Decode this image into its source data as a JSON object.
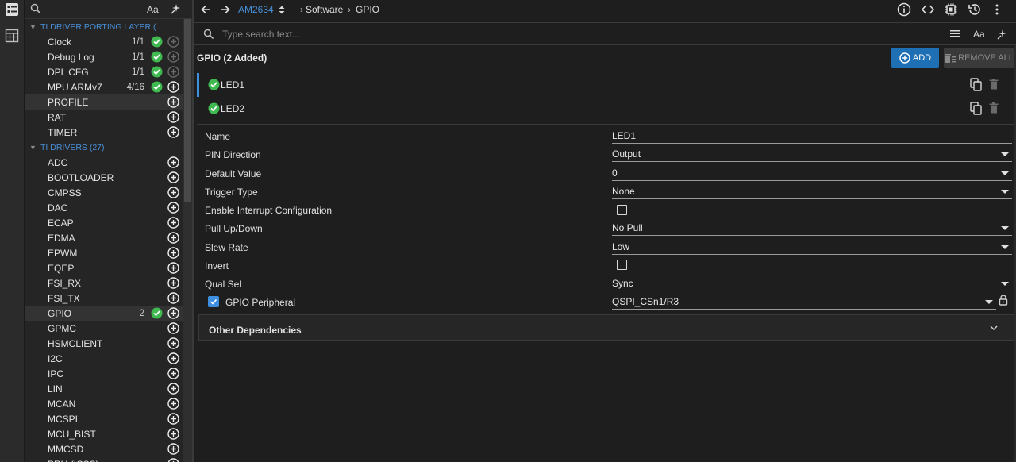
{
  "colors": {
    "accent": "#4a90d9",
    "ok": "#3fb950",
    "add_button": "#1f6fb5",
    "selected_bar": "#3d8fe0"
  },
  "sidebar": {
    "header": {
      "search_icon": "search-icon",
      "font_case": "Aa",
      "magic_icon": "sparkle-icon"
    },
    "categories": [
      {
        "label": "TI DRIVER PORTING LAYER (..."
      },
      {
        "label": "TI DRIVERS (27)"
      }
    ],
    "items": [
      {
        "label": "Clock",
        "count": "1/1",
        "ok": true
      },
      {
        "label": "Debug Log",
        "count": "1/1",
        "ok": true
      },
      {
        "label": "DPL CFG",
        "count": "1/1",
        "ok": true
      },
      {
        "label": "MPU ARMv7",
        "count": "4/16",
        "ok": true
      },
      {
        "label": "PROFILE",
        "count": "",
        "ok": false
      },
      {
        "label": "RAT",
        "count": "",
        "ok": false
      },
      {
        "label": "TIMER",
        "count": "",
        "ok": false
      },
      {
        "label": "ADC",
        "count": "",
        "ok": false
      },
      {
        "label": "BOOTLOADER",
        "count": "",
        "ok": false
      },
      {
        "label": "CMPSS",
        "count": "",
        "ok": false
      },
      {
        "label": "DAC",
        "count": "",
        "ok": false
      },
      {
        "label": "ECAP",
        "count": "",
        "ok": false
      },
      {
        "label": "EDMA",
        "count": "",
        "ok": false
      },
      {
        "label": "EPWM",
        "count": "",
        "ok": false
      },
      {
        "label": "EQEP",
        "count": "",
        "ok": false
      },
      {
        "label": "FSI_RX",
        "count": "",
        "ok": false
      },
      {
        "label": "FSI_TX",
        "count": "",
        "ok": false
      },
      {
        "label": "GPIO",
        "count": "2",
        "ok": true
      },
      {
        "label": "GPMC",
        "count": "",
        "ok": false
      },
      {
        "label": "HSMCLIENT",
        "count": "",
        "ok": false
      },
      {
        "label": "I2C",
        "count": "",
        "ok": false
      },
      {
        "label": "IPC",
        "count": "",
        "ok": false
      },
      {
        "label": "LIN",
        "count": "",
        "ok": false
      },
      {
        "label": "MCAN",
        "count": "",
        "ok": false
      },
      {
        "label": "MCSPI",
        "count": "",
        "ok": false
      },
      {
        "label": "MCU_BIST",
        "count": "",
        "ok": false
      },
      {
        "label": "MMCSD",
        "count": "",
        "ok": false
      },
      {
        "label": "PRU (ICSS)",
        "count": "",
        "ok": false
      }
    ]
  },
  "topbar": {
    "device": "AM2634",
    "crumbs": [
      "Software",
      "GPIO"
    ]
  },
  "search": {
    "placeholder": "Type search text...",
    "font_case": "Aa"
  },
  "main": {
    "title": "GPIO (2 Added)",
    "add_label": "ADD",
    "remove_all_label": "REMOVE ALL",
    "instances": [
      {
        "label": "LED1"
      },
      {
        "label": "LED2"
      }
    ],
    "properties": {
      "name": {
        "label": "Name",
        "value": "LED1"
      },
      "pin_direction": {
        "label": "PIN Direction",
        "value": "Output"
      },
      "default_value": {
        "label": "Default Value",
        "value": "0"
      },
      "trigger_type": {
        "label": "Trigger Type",
        "value": "None"
      },
      "enable_interrupt": {
        "label": "Enable Interrupt Configuration",
        "checked": false
      },
      "pull": {
        "label": "Pull Up/Down",
        "value": "No Pull"
      },
      "slew_rate": {
        "label": "Slew Rate",
        "value": "Low"
      },
      "invert": {
        "label": "Invert",
        "checked": false
      },
      "qual_sel": {
        "label": "Qual Sel",
        "value": "Sync"
      },
      "gpio_peripheral": {
        "label": "GPIO Peripheral",
        "value": "QSPI_CSn1/R3",
        "checked": true
      }
    },
    "other_dependencies": "Other Dependencies"
  }
}
